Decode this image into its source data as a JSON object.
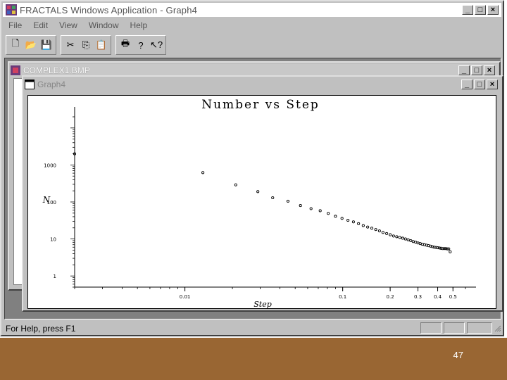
{
  "app": {
    "title": "FRACTALS Windows Application - Graph4",
    "min_glyph": "_",
    "max_glyph": "□",
    "close_glyph": "×"
  },
  "menu": [
    "File",
    "Edit",
    "View",
    "Window",
    "Help"
  ],
  "toolbar": {
    "icons": [
      "new-icon",
      "open-icon",
      "save-icon",
      "cut-icon",
      "copy-icon",
      "paste-icon",
      "print-icon",
      "help-icon",
      "context-help-icon"
    ],
    "glyphs": [
      "🗋",
      "📂",
      "💾",
      "✂",
      "⎘",
      "📋",
      "🖶",
      "?",
      "↖?"
    ]
  },
  "windows": {
    "complex": {
      "title": "COMPLEX1.BMP"
    },
    "graph": {
      "title": "Graph4"
    }
  },
  "status": {
    "text": "For Help, press F1"
  },
  "footer": {
    "page_number": "47",
    "color": "#996633"
  },
  "chart_data": {
    "type": "scatter",
    "title": "Number vs Step",
    "xlabel": "Step",
    "ylabel": "N",
    "xscale": "log",
    "yscale": "log",
    "xlim": [
      0.002,
      0.7
    ],
    "ylim": [
      0.5,
      20000
    ],
    "xticks": [
      0.01,
      0.1,
      0.2,
      0.3,
      0.4,
      0.5
    ],
    "xtick_labels": [
      "0.01",
      "0.1",
      "0.2",
      "0.3",
      "0.4",
      "0.5"
    ],
    "yticks": [
      1,
      10,
      100,
      1000
    ],
    "ytick_labels": [
      "1",
      "10",
      "100",
      "1000"
    ],
    "x": [
      0.002,
      0.013,
      0.021,
      0.029,
      0.036,
      0.045,
      0.054,
      0.063,
      0.072,
      0.081,
      0.09,
      0.099,
      0.108,
      0.117,
      0.126,
      0.135,
      0.144,
      0.153,
      0.162,
      0.171,
      0.18,
      0.19,
      0.2,
      0.21,
      0.22,
      0.23,
      0.24,
      0.25,
      0.26,
      0.27,
      0.28,
      0.29,
      0.3,
      0.31,
      0.32,
      0.33,
      0.34,
      0.35,
      0.36,
      0.37,
      0.38,
      0.39,
      0.4,
      0.41,
      0.42,
      0.43,
      0.44,
      0.45,
      0.46,
      0.47,
      0.48
    ],
    "y": [
      2000,
      620,
      290,
      190,
      130,
      105,
      80,
      66,
      58,
      49,
      41,
      36,
      32,
      29,
      26,
      23,
      21,
      19.5,
      18,
      16.5,
      15,
      14,
      13,
      12,
      11.5,
      11,
      10.5,
      10,
      9.5,
      9,
      8.5,
      8.2,
      7.8,
      7.5,
      7.2,
      7,
      6.8,
      6.6,
      6.4,
      6.2,
      6,
      5.9,
      5.8,
      5.7,
      5.6,
      5.5,
      5.5,
      5.5,
      5.4,
      5.4,
      4.5
    ]
  }
}
